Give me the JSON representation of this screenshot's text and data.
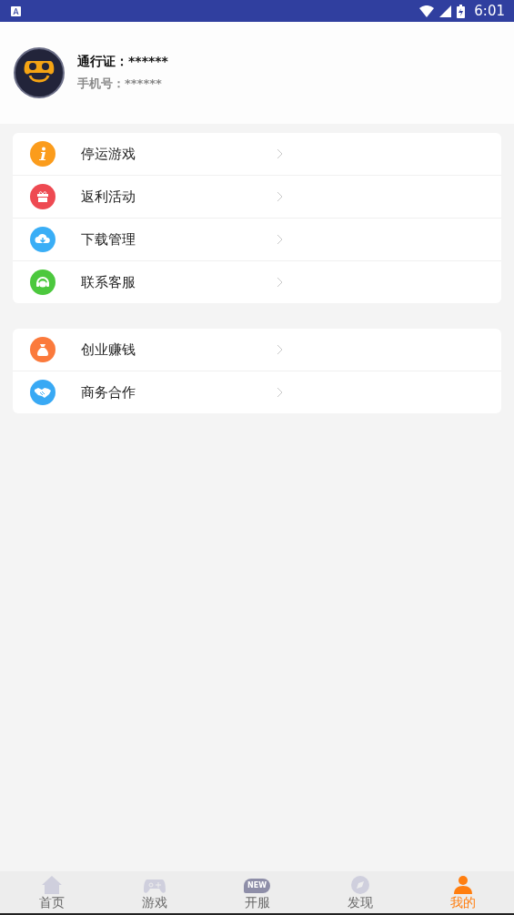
{
  "status_bar": {
    "time": "6:01"
  },
  "profile": {
    "account": "通行证：******",
    "phone": "手机号：******"
  },
  "menu_groups": [
    [
      {
        "label": "停运游戏",
        "kind": "info",
        "color": "#fb9c1c"
      },
      {
        "label": "返利活动",
        "kind": "gift",
        "color": "#ee4a52"
      },
      {
        "label": "下载管理",
        "kind": "cloud",
        "color": "#3aaef6"
      },
      {
        "label": "联系客服",
        "kind": "headset",
        "color": "#4cc83e"
      }
    ],
    [
      {
        "label": "创业赚钱",
        "kind": "bag",
        "color": "#fb7a3c"
      },
      {
        "label": "商务合作",
        "kind": "handshake",
        "color": "#39a9f4"
      }
    ]
  ],
  "tabs": [
    {
      "label": "首页",
      "kind": "home",
      "selected": false
    },
    {
      "label": "游戏",
      "kind": "gamepad",
      "selected": false
    },
    {
      "label": "开服",
      "kind": "bubble",
      "badge": "NEW",
      "selected": false
    },
    {
      "label": "发现",
      "kind": "compass",
      "selected": false
    },
    {
      "label": "我的",
      "kind": "person",
      "selected": true
    }
  ]
}
